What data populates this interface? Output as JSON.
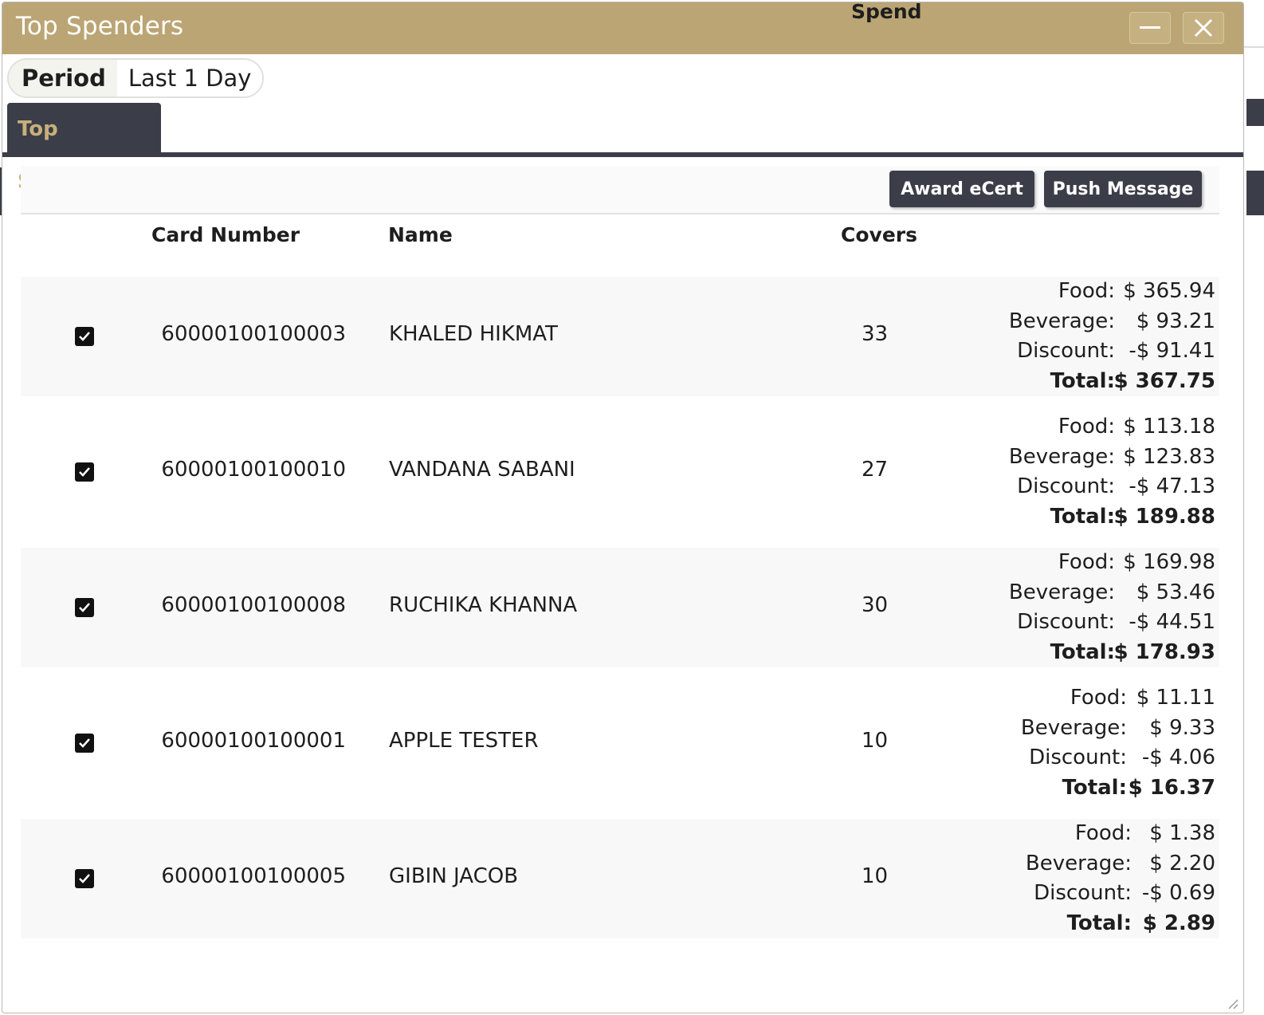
{
  "dialog": {
    "title": "Top Spenders",
    "colors": {
      "titlebar": "#bba574",
      "dark": "#3b3e48",
      "tab_text": "#c8b07a"
    }
  },
  "period": {
    "label": "Period",
    "value": "Last 1 Day"
  },
  "tabs": [
    {
      "label": "Top Spenders",
      "active": true
    }
  ],
  "toolbar": {
    "award_label": "Award eCert",
    "push_label": "Push Message"
  },
  "table": {
    "columns": {
      "card": "Card Number",
      "name": "Name",
      "covers": "Covers",
      "spend": "Spend"
    },
    "spend_labels": {
      "food": "Food:",
      "beverage": "Beverage:",
      "discount": "Discount:",
      "total": "Total:"
    },
    "rows": [
      {
        "checked": true,
        "card": "60000100100003",
        "name": "KHALED HIKMAT",
        "covers": "33",
        "food": "$ 365.94",
        "beverage": "$ 93.21",
        "discount": "-$ 91.41",
        "total": "$ 367.75"
      },
      {
        "checked": true,
        "card": "60000100100010",
        "name": "VANDANA SABANI",
        "covers": "27",
        "food": "$ 113.18",
        "beverage": "$ 123.83",
        "discount": "-$ 47.13",
        "total": "$ 189.88"
      },
      {
        "checked": true,
        "card": "60000100100008",
        "name": "RUCHIKA KHANNA",
        "covers": "30",
        "food": "$ 169.98",
        "beverage": "$ 53.46",
        "discount": "-$ 44.51",
        "total": "$ 178.93"
      },
      {
        "checked": true,
        "card": "60000100100001",
        "name": "APPLE TESTER",
        "covers": "10",
        "food": "$ 11.11",
        "beverage": "$ 9.33",
        "discount": "-$ 4.06",
        "total": "$ 16.37"
      },
      {
        "checked": true,
        "card": "60000100100005",
        "name": "GIBIN JACOB",
        "covers": "10",
        "food": "$ 1.38",
        "beverage": "$ 2.20",
        "discount": "-$ 0.69",
        "total": "$ 2.89"
      }
    ]
  }
}
